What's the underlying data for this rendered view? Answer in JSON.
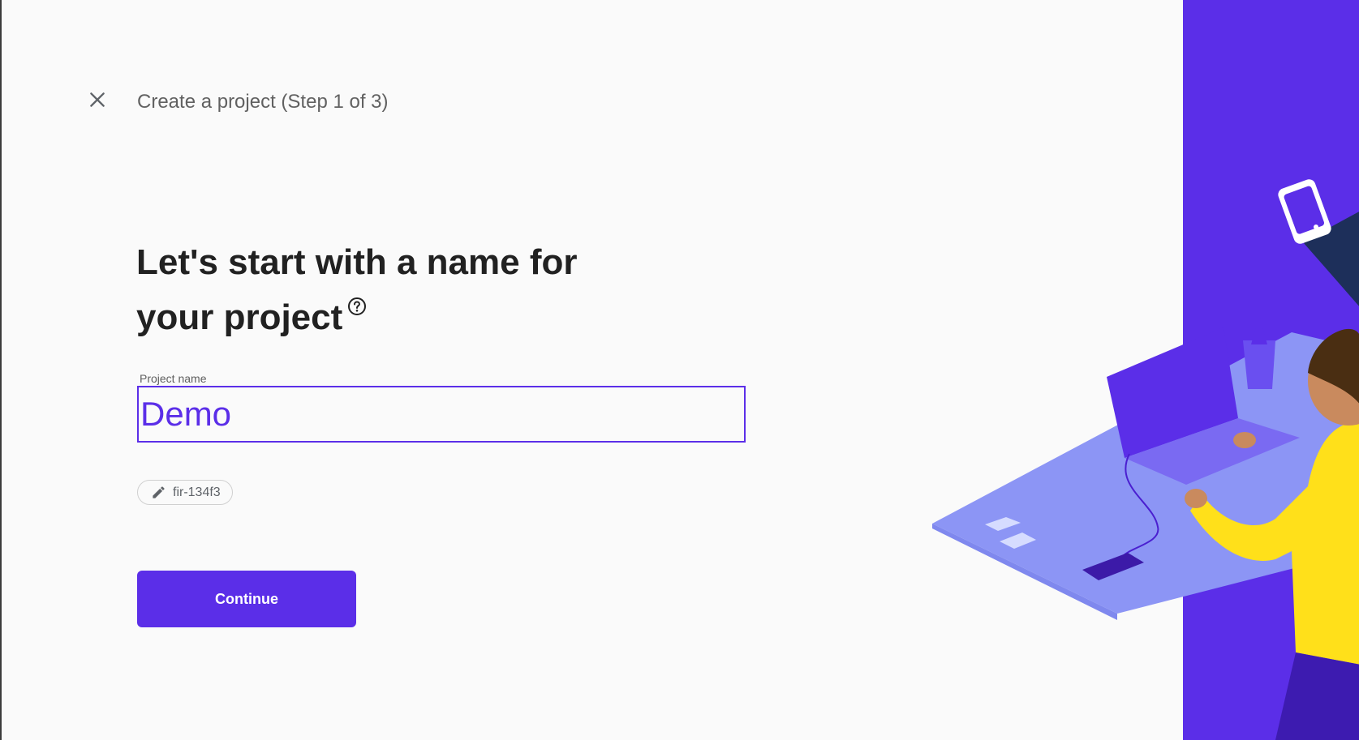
{
  "header": {
    "close_icon": "close-icon",
    "title": "Create a project (Step 1 of 3)"
  },
  "main": {
    "headline_line1": "Let's start with a name for",
    "headline_line2": "your project",
    "help_icon": "help-circle-icon",
    "project_name_label": "Project name",
    "project_name_value": "Demo",
    "project_id_chip": "fir-134f3",
    "edit_icon": "pencil-icon",
    "continue_label": "Continue"
  },
  "colors": {
    "accent": "#5b2ee8",
    "background": "#fafafa",
    "illustration_desk": "#8c95f5",
    "illustration_person_shirt": "#ffe01a"
  }
}
